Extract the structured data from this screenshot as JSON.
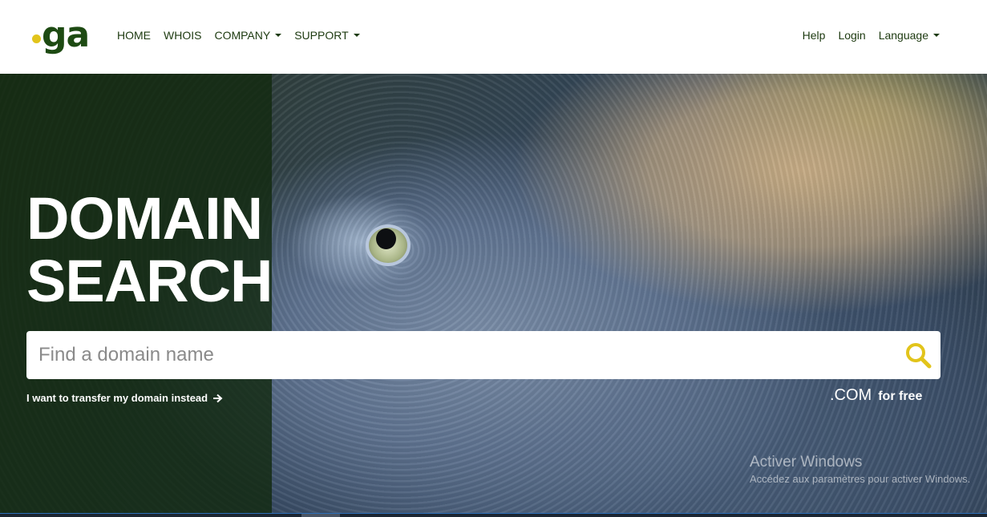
{
  "brand": {
    "logo_text": "ga",
    "accent_color": "#e2c41b",
    "primary_color": "#1d4a12"
  },
  "nav": {
    "left": [
      {
        "label": "HOME"
      },
      {
        "label": "WHOIS"
      },
      {
        "label": "COMPANY",
        "dropdown": true
      },
      {
        "label": "SUPPORT",
        "dropdown": true
      }
    ],
    "right": [
      {
        "label": "Help"
      },
      {
        "label": "Login"
      },
      {
        "label": "Language",
        "dropdown": true
      }
    ]
  },
  "hero": {
    "title_line1": "DOMAIN",
    "title_line2": "SEARCH",
    "search_placeholder": "Find a domain name",
    "search_value": "",
    "search_icon": "search-icon",
    "transfer_link": "I want to transfer my domain instead",
    "transfer_icon": "arrow-right-icon",
    "promo_tld": ".COM",
    "promo_text": "for free"
  },
  "os_watermark": {
    "title": "Activer Windows",
    "subtitle": "Accédez aux paramètres pour activer Windows."
  }
}
